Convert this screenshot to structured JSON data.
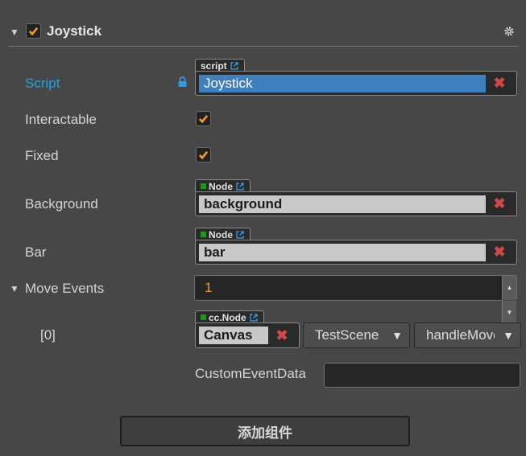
{
  "component": {
    "title": "Joystick",
    "enabled": true
  },
  "props": {
    "script": {
      "label": "Script",
      "tag": "script",
      "value": "Joystick"
    },
    "interactable": {
      "label": "Interactable",
      "checked": true
    },
    "fixed": {
      "label": "Fixed",
      "checked": true
    },
    "background": {
      "label": "Background",
      "tag": "Node",
      "value": "background"
    },
    "bar": {
      "label": "Bar",
      "tag": "Node",
      "value": "bar"
    },
    "move_events": {
      "label": "Move Events",
      "count": "1",
      "items": [
        {
          "index": "[0]",
          "tag": "cc.Node",
          "target": "Canvas",
          "component": "TestScene",
          "handler": "handleMove",
          "custom_label": "CustomEventData",
          "custom_value": ""
        }
      ]
    }
  },
  "add_component_label": "添加组件",
  "colors": {
    "accent": "#f09a2a",
    "selected": "#3e7fbf",
    "active_label": "#2f9ae6",
    "remove": "#d24848"
  }
}
